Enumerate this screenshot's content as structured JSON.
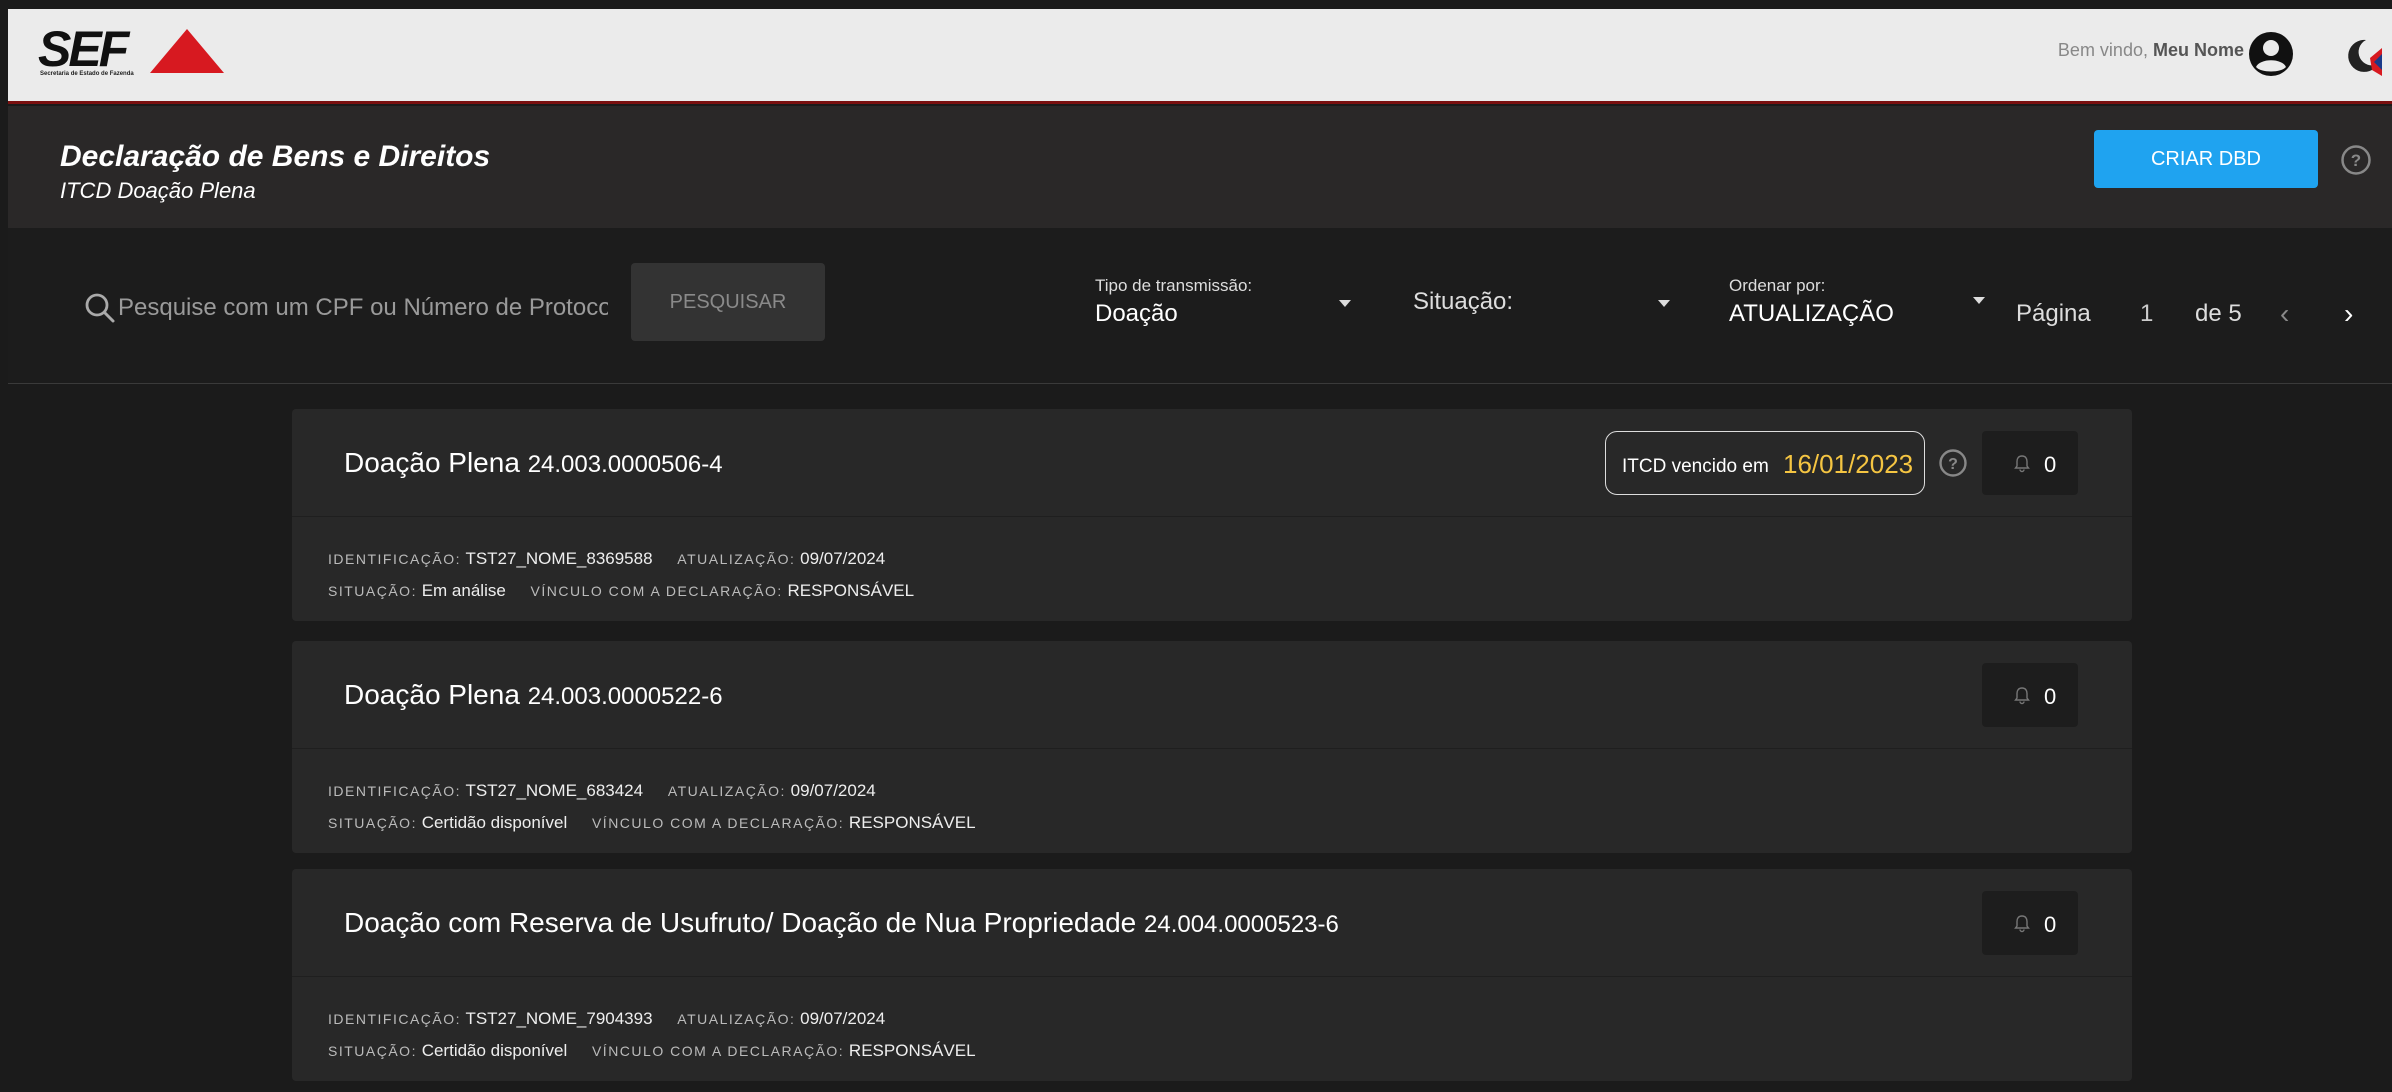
{
  "header_bar": {
    "logo_text": "SEF",
    "logo_subtitle": "Secretaria de Estado de Fazenda",
    "welcome_prefix": "Bem vindo,",
    "user_name": "Meu Nome",
    "brand_red": "#d71920"
  },
  "page": {
    "title": "Declaração de Bens e Direitos",
    "subtitle": "ITCD Doação Plena",
    "create_button": "CRIAR DBD",
    "accent": "#1fa3f0"
  },
  "filters": {
    "search_placeholder": "Pesquise com um CPF ou Número de Protocolo",
    "search_button": "PESQUISAR",
    "transmission_label": "Tipo de transmissão:",
    "transmission_value": "Doação",
    "situation_label": "Situação:",
    "order_label": "Ordenar por:",
    "order_value": "ATUALIZAÇÃO",
    "page_label": "Página",
    "page_current": "1",
    "page_total": "de 5",
    "prev_symbol": "‹",
    "next_symbol": "›"
  },
  "labels": {
    "identification": "IDENTIFICAÇÃO:",
    "update": "ATUALIZAÇÃO:",
    "situation": "SITUAÇÃO:",
    "link": "VÍNCULO COM A DECLARAÇÃO:"
  },
  "declarations": [
    {
      "type": "Doação Plena",
      "protocol": "24.003.0000506-4",
      "identification": "TST27_NOME_8369588",
      "updated": "09/07/2024",
      "situation": "Em análise",
      "link": "RESPONSÁVEL",
      "notifications": "0",
      "overdue_label": "ITCD vencido em",
      "overdue_date": "16/01/2023"
    },
    {
      "type": "Doação Plena",
      "protocol": "24.003.0000522-6",
      "identification": "TST27_NOME_683424",
      "updated": "09/07/2024",
      "situation": "Certidão disponível",
      "link": "RESPONSÁVEL",
      "notifications": "0"
    },
    {
      "type": "Doação com Reserva de Usufruto/ Doação de Nua Propriedade",
      "protocol": "24.004.0000523-6",
      "identification": "TST27_NOME_7904393",
      "updated": "09/07/2024",
      "situation": "Certidão disponível",
      "link": "RESPONSÁVEL",
      "notifications": "0"
    }
  ]
}
